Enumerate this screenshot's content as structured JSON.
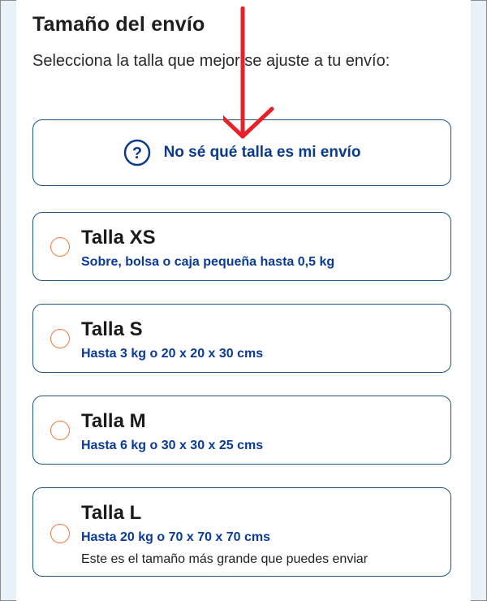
{
  "section": {
    "title": "Tamaño del envío",
    "subtitle": "Selecciona la talla que mejor se ajuste a tu envío:"
  },
  "help": {
    "label": "No sé qué talla es mi envío",
    "icon": "question-circle-icon"
  },
  "options": [
    {
      "title": "Talla XS",
      "description": "Sobre, bolsa o caja pequeña hasta 0,5 kg"
    },
    {
      "title": "Talla S",
      "description": "Hasta 3 kg o 20 x 20 x 30 cms"
    },
    {
      "title": "Talla M",
      "description": "Hasta 6 kg o 30 x 30 x 25 cms"
    },
    {
      "title": "Talla L",
      "description": "Hasta 20 kg o 70 x 70 x 70 cms",
      "note": "Este es el tamaño más grande que puedes enviar"
    }
  ],
  "colors": {
    "border": "#1a5680",
    "accent_blue": "#0a3a8c",
    "radio_orange": "#f07a3a",
    "arrow_red": "#e8202a",
    "frame_bg": "#e8f0f8"
  },
  "annotation": {
    "icon": "red-arrow-down-icon"
  }
}
